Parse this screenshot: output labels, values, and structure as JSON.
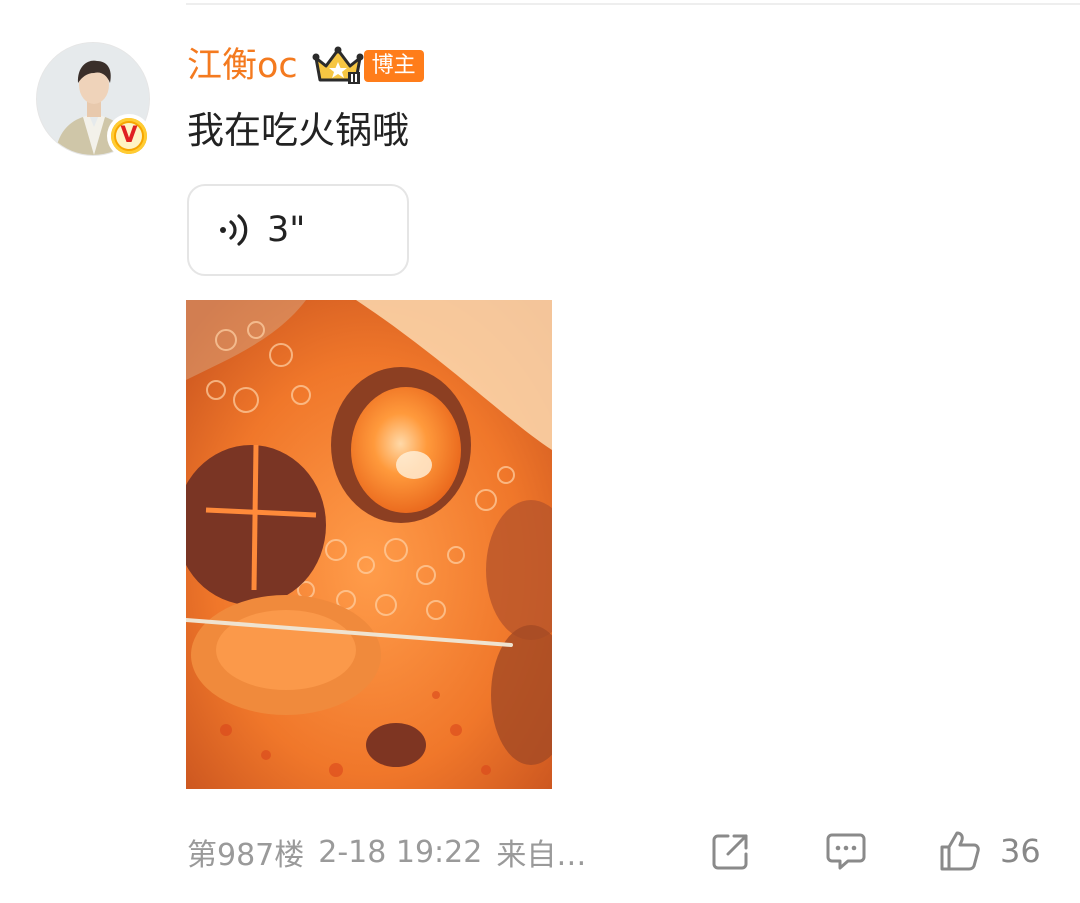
{
  "post": {
    "username": "江衡oc",
    "badge_label": "博主",
    "text": "我在吃火锅哦",
    "voice": {
      "duration": "3\""
    },
    "photo_description_icon": "hotpot-photo"
  },
  "footer": {
    "floor": "第987楼",
    "datetime": "2-18 19:22",
    "source": "来自…",
    "like_count": "36"
  },
  "colors": {
    "username": "#f47a1f",
    "badge_bg": "#ff7d1a",
    "meta_text": "#9a9a9a",
    "verified": "#f7a600"
  },
  "icons": {
    "verified": "verified-v-icon",
    "crown": "crown-level-icon",
    "voice": "voice-wave-icon",
    "share": "share-icon",
    "comment": "comment-icon",
    "like": "thumbs-up-icon"
  }
}
